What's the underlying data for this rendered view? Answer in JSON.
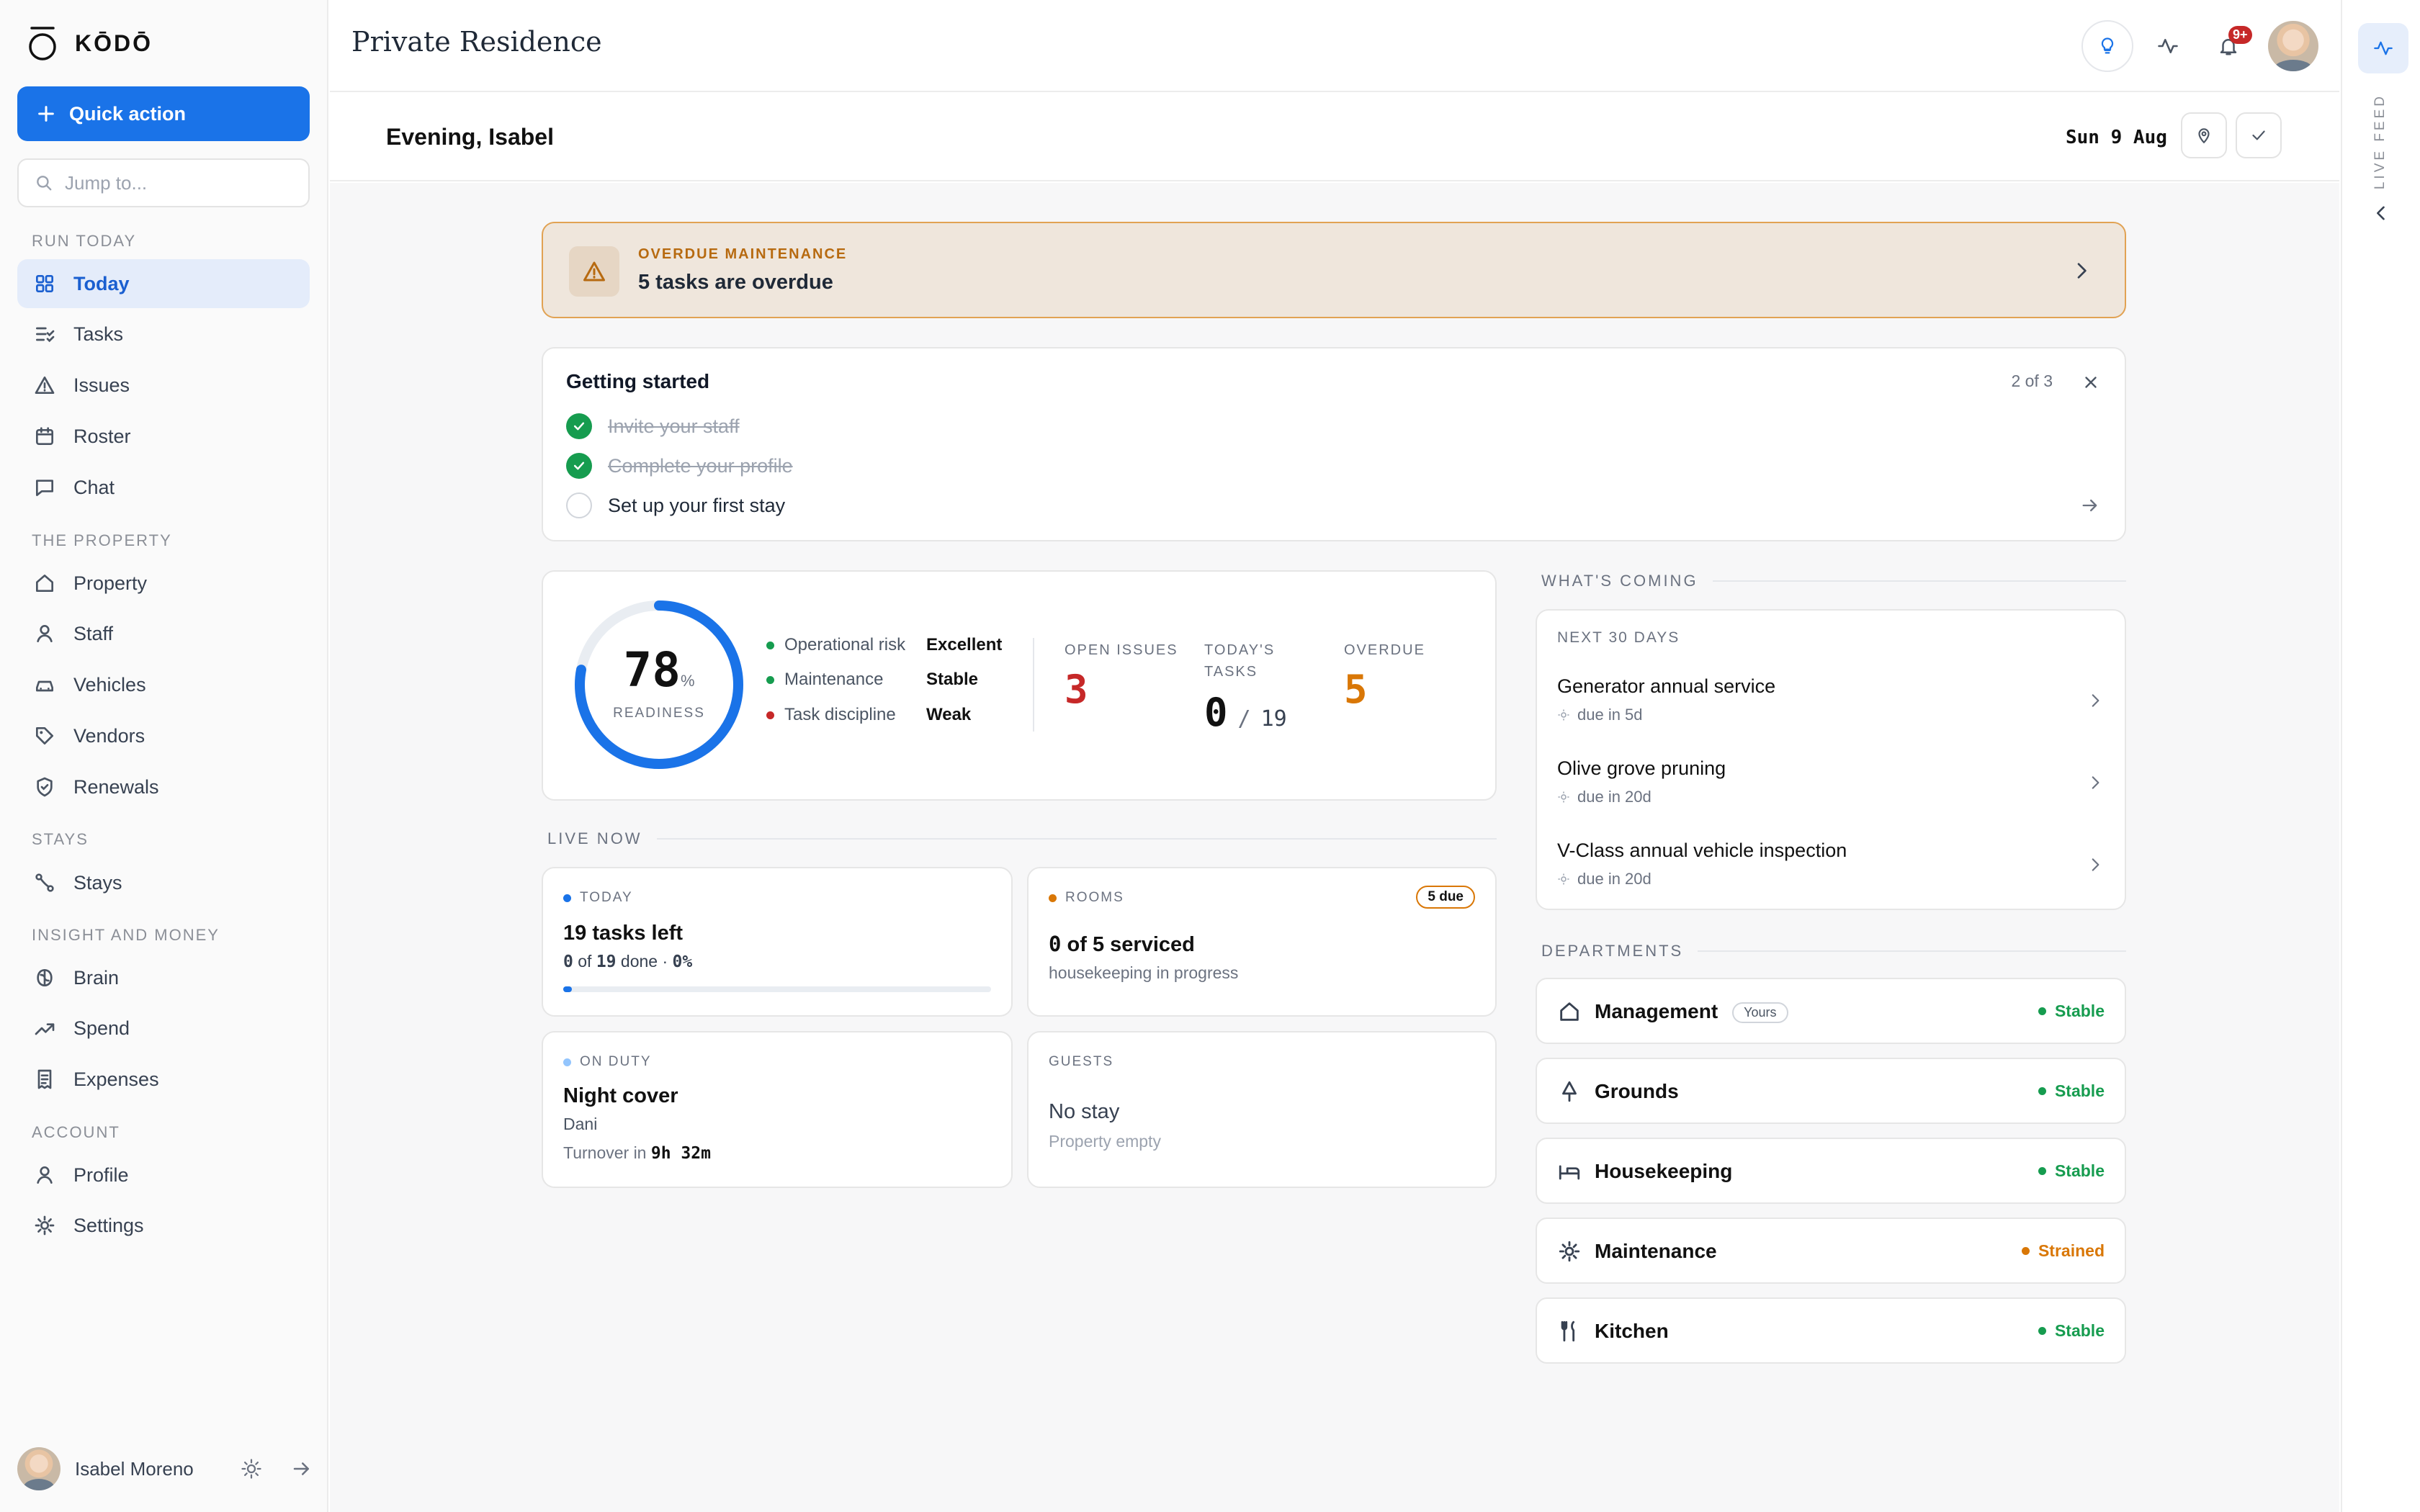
{
  "sidebar": {
    "brand": "KŌDŌ",
    "quick_action": "Quick action",
    "search_placeholder": "Jump to...",
    "sections": {
      "run_today": "RUN TODAY",
      "property": "THE PROPERTY",
      "stays": "STAYS",
      "insight": "INSIGHT AND MONEY",
      "account": "ACCOUNT"
    },
    "items": {
      "today": "Today",
      "tasks": "Tasks",
      "issues": "Issues",
      "roster": "Roster",
      "chat": "Chat",
      "property": "Property",
      "staff": "Staff",
      "vehicles": "Vehicles",
      "vendors": "Vendors",
      "renewals": "Renewals",
      "stays": "Stays",
      "brain": "Brain",
      "spend": "Spend",
      "expenses": "Expenses",
      "profile": "Profile",
      "settings": "Settings"
    },
    "user_name": "Isabel Moreno"
  },
  "header": {
    "title": "Private Residence",
    "notifications_badge": "9+",
    "greeting": "Evening, Isabel",
    "date": "Sun 9 Aug"
  },
  "right_rail": {
    "label": "LIVE FEED"
  },
  "alert": {
    "label": "OVERDUE MAINTENANCE",
    "message": "5 tasks are overdue"
  },
  "getting_started": {
    "title": "Getting started",
    "progress": "2 of 3",
    "steps": [
      {
        "label": "Invite your staff",
        "done": true
      },
      {
        "label": "Complete your profile",
        "done": true
      },
      {
        "label": "Set up your first stay",
        "done": false
      }
    ]
  },
  "readiness": {
    "value": 78,
    "value_text": "78",
    "unit": "%",
    "label": "READINESS",
    "factors": [
      {
        "name": "Operational risk",
        "status": "Excellent",
        "color": "#169c4f"
      },
      {
        "name": "Maintenance",
        "status": "Stable",
        "color": "#169c4f"
      },
      {
        "name": "Task discipline",
        "status": "Weak",
        "color": "#c62828"
      }
    ],
    "metrics": {
      "open_issues": {
        "label": "OPEN ISSUES",
        "value": "3"
      },
      "todays_tasks": {
        "label_1": "TODAY'S",
        "label_2": "TASKS",
        "done": "0",
        "sep": "/",
        "total": "19"
      },
      "overdue": {
        "label": "OVERDUE",
        "value": "5"
      }
    }
  },
  "live_now": {
    "heading": "LIVE NOW",
    "today": {
      "label": "TODAY",
      "title": "19 tasks left",
      "done": "0",
      "of": "of",
      "total": "19",
      "done_word": "done ·",
      "percent": "0%",
      "progress": 0.02
    },
    "rooms": {
      "label": "ROOMS",
      "badge": "5 due",
      "title_num": "0",
      "title_rest": "of 5 serviced",
      "sub": "housekeeping in progress"
    },
    "on_duty": {
      "label": "ON DUTY",
      "title": "Night cover",
      "person": "Dani",
      "turnover_label": "Turnover in",
      "turnover_value": "9h 32m"
    },
    "guests": {
      "label": "GUESTS",
      "title": "No stay",
      "sub": "Property empty"
    }
  },
  "whats_coming": {
    "heading": "WHAT'S COMING",
    "subheading": "NEXT 30 DAYS",
    "items": [
      {
        "title": "Generator annual service",
        "due": "due in 5d"
      },
      {
        "title": "Olive grove pruning",
        "due": "due in 20d"
      },
      {
        "title": "V-Class annual vehicle inspection",
        "due": "due in 20d"
      }
    ]
  },
  "departments": {
    "heading": "DEPARTMENTS",
    "yours_label": "Yours",
    "items": [
      {
        "name": "Management",
        "status": "Stable",
        "color": "#169c4f",
        "icon": "home-icon"
      },
      {
        "name": "Grounds",
        "status": "Stable",
        "color": "#169c4f",
        "icon": "tree-icon"
      },
      {
        "name": "Housekeeping",
        "status": "Stable",
        "color": "#169c4f",
        "icon": "bed-icon"
      },
      {
        "name": "Maintenance",
        "status": "Strained",
        "color": "#d97706",
        "icon": "gear-icon"
      },
      {
        "name": "Kitchen",
        "status": "Stable",
        "color": "#169c4f",
        "icon": "utensils-icon"
      }
    ]
  },
  "colors": {
    "accent": "#1a73e8",
    "success": "#169c4f",
    "danger": "#c62828",
    "warning": "#d97706"
  }
}
